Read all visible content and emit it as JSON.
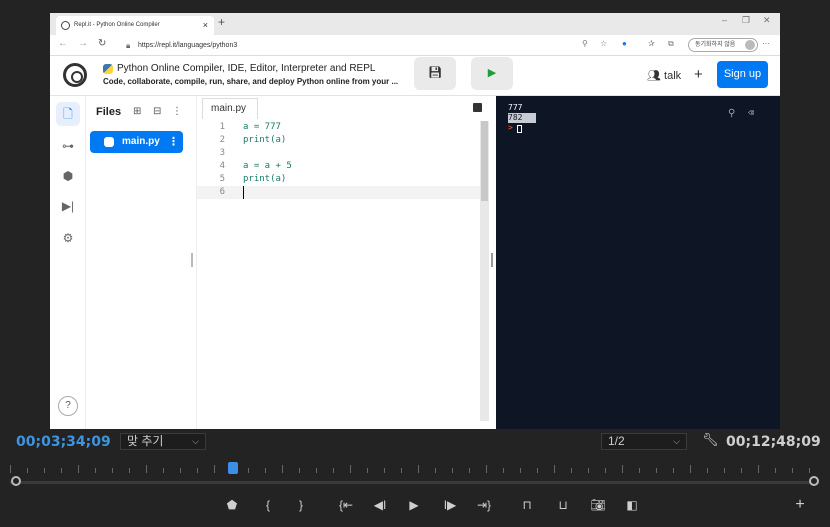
{
  "browser": {
    "tab_title": "Repl.it - Python Online Compiler",
    "tab_close": "×",
    "new_tab": "+",
    "url": "https://repl.it/languages/python3",
    "profile_label": "동기화하지 않음",
    "window_controls": [
      "–",
      "❐",
      "✕"
    ]
  },
  "replit": {
    "title": "Python Online Compiler, IDE, Editor, Interpreter and REPL",
    "subtitle": "Code, collaborate, compile, run, share, and deploy Python online from your ...",
    "talk_label": "talk",
    "plus_label": "+",
    "signup_label": "Sign up"
  },
  "files_panel": {
    "header": "Files",
    "items": [
      {
        "label": "main.py"
      }
    ]
  },
  "editor": {
    "tab_label": "main.py",
    "lines": [
      {
        "num": "1",
        "text": "a = 777"
      },
      {
        "num": "2",
        "text": "print(a)"
      },
      {
        "num": "3",
        "text": ""
      },
      {
        "num": "4",
        "text": "a = a + 5"
      },
      {
        "num": "5",
        "text": "print(a)"
      },
      {
        "num": "6",
        "text": ""
      }
    ]
  },
  "console": {
    "output": [
      "777",
      "782"
    ],
    "prompt": ">"
  },
  "player": {
    "current_timecode": "00;03;34;09",
    "fit_label": "맞 추기",
    "resolution_label": "1/2",
    "duration_timecode": "00;12;48;09",
    "help_label": "?"
  },
  "icons": {
    "save": "save-icon",
    "run": "run-icon",
    "wrench": "wrench-icon"
  }
}
